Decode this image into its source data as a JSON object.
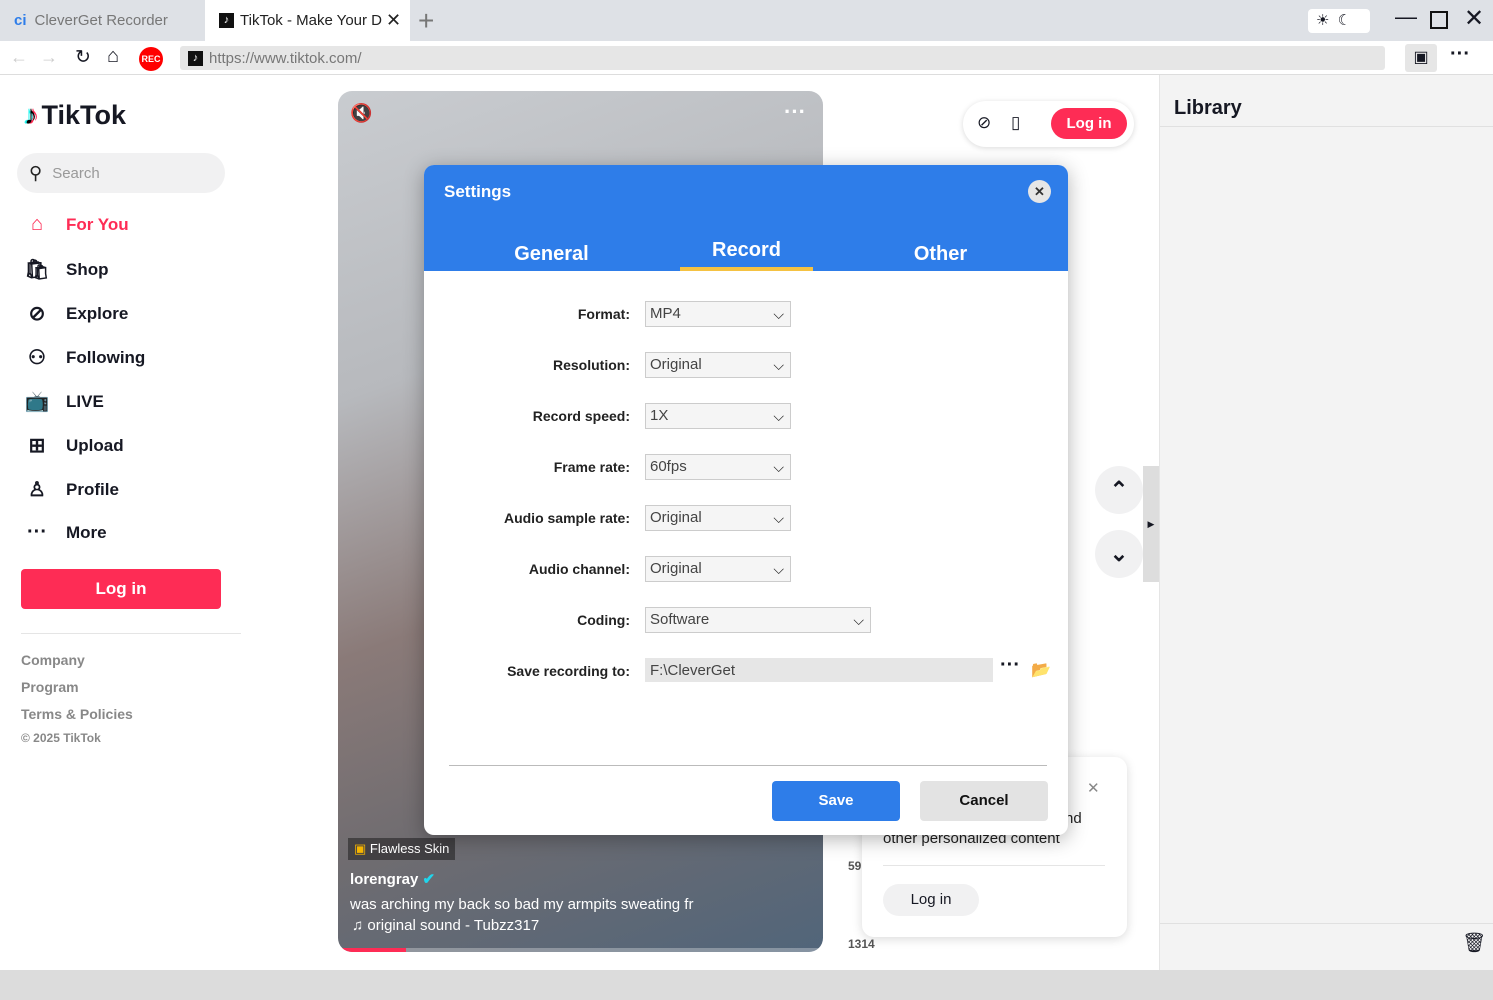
{
  "browser": {
    "tabs": [
      {
        "label": "CleverGet Recorder"
      },
      {
        "label": "TikTok - Make Your D"
      }
    ],
    "url": "https://www.tiktok.com/",
    "rec_label": "REC"
  },
  "sidebar": {
    "logo": "TikTok",
    "search_placeholder": "Search",
    "items": [
      {
        "label": "For You"
      },
      {
        "label": "Shop"
      },
      {
        "label": "Explore"
      },
      {
        "label": "Following"
      },
      {
        "label": "LIVE"
      },
      {
        "label": "Upload"
      },
      {
        "label": "Profile"
      },
      {
        "label": "More"
      }
    ],
    "login": "Log in",
    "footer": [
      "Company",
      "Program",
      "Terms & Policies",
      "© 2025 TikTok"
    ]
  },
  "video": {
    "effect": "Flawless Skin",
    "user": "lorengray",
    "caption": "was arching my back so bad my armpits sweating fr",
    "sound": "original sound - Tubzz317",
    "count1": "59",
    "count2": "1314"
  },
  "header": {
    "login": "Log in"
  },
  "popup": {
    "text_partial": "nd",
    "text": "other personalized content",
    "login": "Log in"
  },
  "library": {
    "title": "Library"
  },
  "settings": {
    "title": "Settings",
    "tabs": [
      "General",
      "Record",
      "Other"
    ],
    "active_tab": "Record",
    "rows": [
      {
        "label": "Format:",
        "value": "MP4"
      },
      {
        "label": "Resolution:",
        "value": "Original"
      },
      {
        "label": "Record speed:",
        "value": "1X"
      },
      {
        "label": "Frame rate:",
        "value": "60fps"
      },
      {
        "label": "Audio sample rate:",
        "value": "Original"
      },
      {
        "label": "Audio channel:",
        "value": "Original"
      },
      {
        "label": "Coding:",
        "value": "Software"
      }
    ],
    "save_label": "Save recording to:",
    "save_path": "F:\\CleverGet",
    "save": "Save",
    "cancel": "Cancel"
  }
}
